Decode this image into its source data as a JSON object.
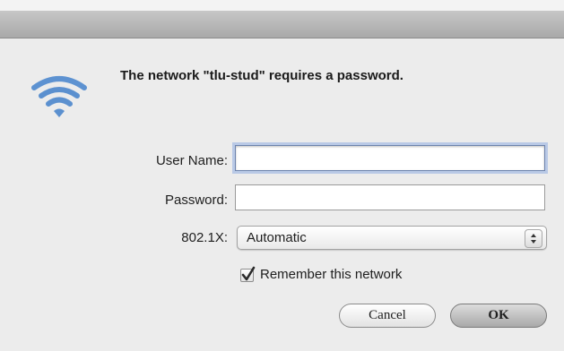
{
  "dialog": {
    "message": "The network \"tlu-stud\" requires a password.",
    "icon": "wifi-icon"
  },
  "form": {
    "username_label": "User Name:",
    "username_value": "",
    "password_label": "Password:",
    "password_value": "",
    "security_label": "802.1X:",
    "security_selected": "Automatic",
    "remember_label": "Remember this network",
    "remember_checked": true
  },
  "buttons": {
    "cancel_label": "Cancel",
    "ok_label": "OK"
  },
  "colors": {
    "wifi_blue": "#4f86c8",
    "focus_ring": "#b9c9e6"
  }
}
